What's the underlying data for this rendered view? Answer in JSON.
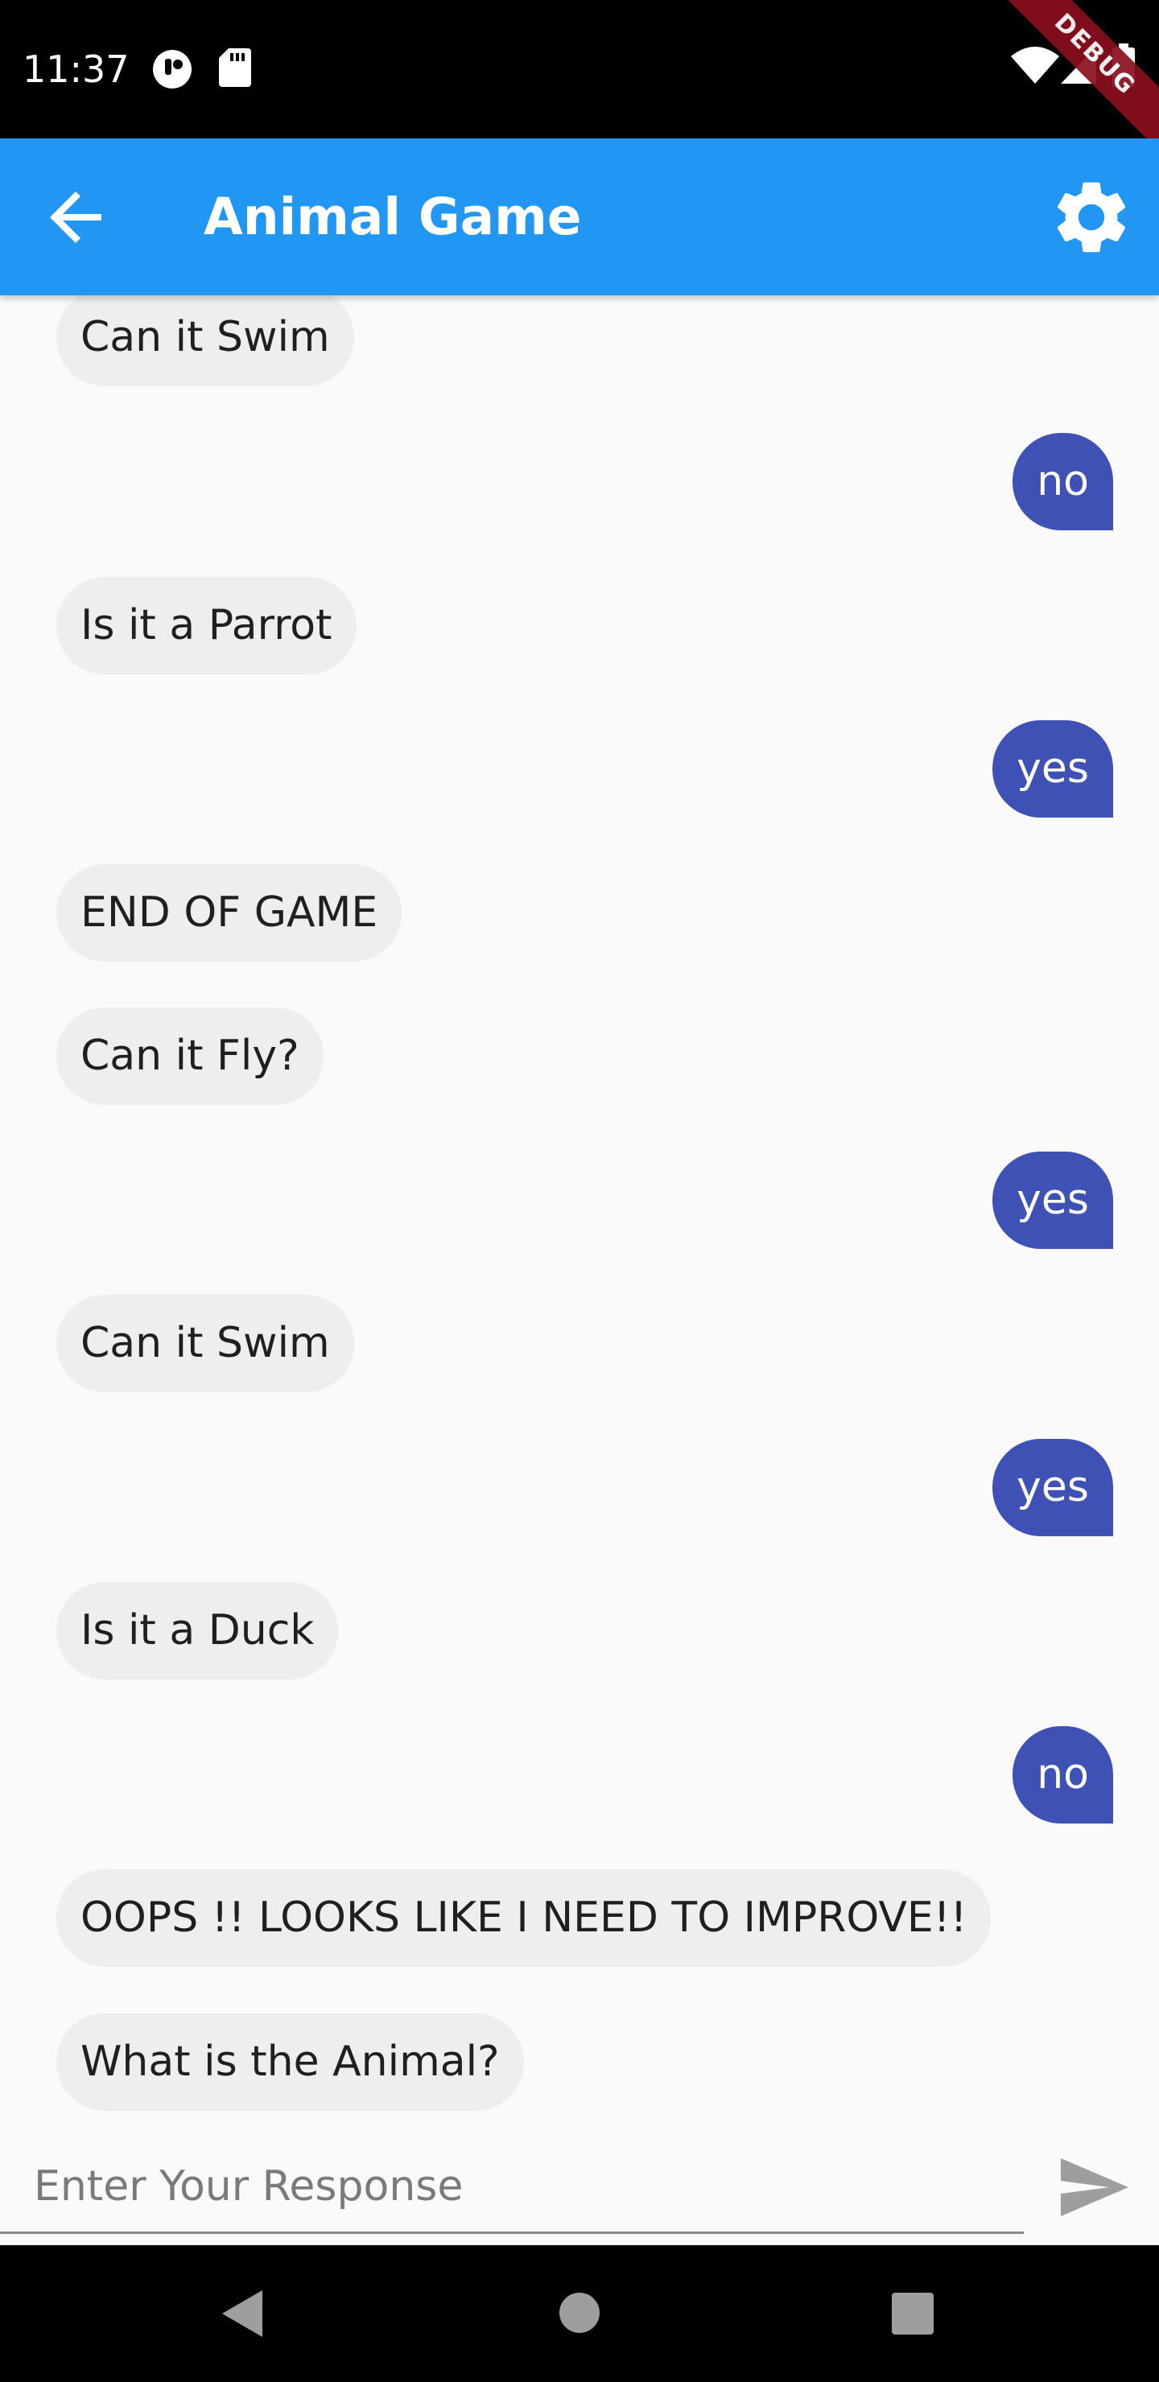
{
  "status_bar": {
    "time": "11:37",
    "debug_label": "DEBUG"
  },
  "app_bar": {
    "title": "Animal Game",
    "back_icon": "arrow-back-icon",
    "settings_icon": "gear-icon",
    "color": "#2196f3"
  },
  "messages": [
    {
      "sender": "bot",
      "text": "Can it Swim"
    },
    {
      "sender": "user",
      "text": "no"
    },
    {
      "sender": "bot",
      "text": " Is it a Parrot"
    },
    {
      "sender": "user",
      "text": "yes"
    },
    {
      "sender": "bot",
      "text": "END OF GAME"
    },
    {
      "sender": "bot",
      "text": "Can it Fly?"
    },
    {
      "sender": "user",
      "text": "yes"
    },
    {
      "sender": "bot",
      "text": "Can it Swim"
    },
    {
      "sender": "user",
      "text": "yes"
    },
    {
      "sender": "bot",
      "text": " Is it a Duck"
    },
    {
      "sender": "user",
      "text": "no"
    },
    {
      "sender": "bot",
      "text": "OOPS !! LOOKS LIKE I NEED TO IMPROVE!!"
    },
    {
      "sender": "bot",
      "text": "What is the Animal?"
    }
  ],
  "input": {
    "placeholder": "Enter Your Response",
    "value": "",
    "send_icon": "send-icon"
  },
  "nav_bar": {
    "back_icon": "nav-back-icon",
    "home_icon": "nav-home-icon",
    "recents_icon": "nav-recents-icon"
  },
  "colors": {
    "user_bubble": "#3f51b5",
    "bot_bubble": "#eeeeee",
    "background": "#fafafa"
  }
}
